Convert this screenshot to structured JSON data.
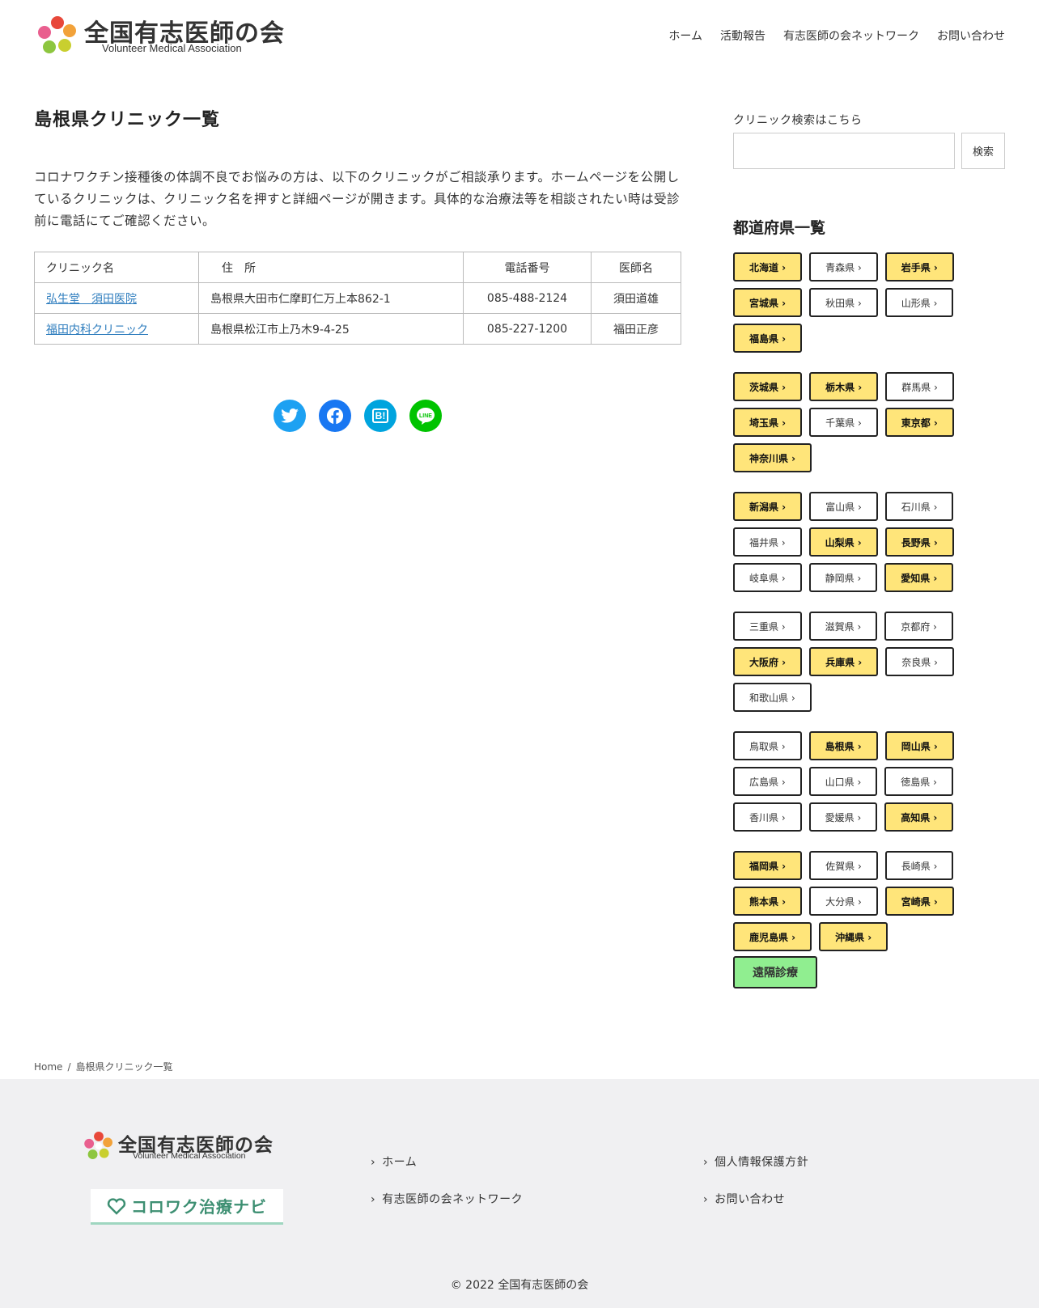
{
  "header": {
    "logo_title": "全国有志医師の会",
    "logo_subtitle": "Volunteer Medical Association",
    "nav": [
      "ホーム",
      "活動報告",
      "有志医師の会ネットワーク",
      "お問い合わせ"
    ]
  },
  "main": {
    "title": "島根県クリニック一覧",
    "intro": "コロナワクチン接種後の体調不良でお悩みの方は、以下のクリニックがご相談承ります。ホームページを公開しているクリニックは、クリニック名を押すと詳細ページが開きます。具体的な治療法等を相談されたい時は受診前に電話にてご確認ください。",
    "table": {
      "headers": [
        "クリニック名",
        "住　所",
        "電話番号",
        "医師名"
      ],
      "rows": [
        [
          "弘生堂　須田医院",
          "島根県大田市仁摩町仁万上本862-1",
          "085-488-2124",
          "須田道雄"
        ],
        [
          "福田内科クリニック",
          "島根県松江市上乃木9-4-25",
          "085-227-1200",
          "福田正彦"
        ]
      ]
    },
    "share": {
      "twitter_color": "#1da1f2",
      "facebook_color": "#1877f2",
      "hatena_color": "#00a4de",
      "line_color": "#00c300",
      "hatena_label": "B!"
    }
  },
  "sidebar": {
    "search_label": "クリニック検索はこちら",
    "search_button": "検索",
    "pref_title": "都道府県一覧",
    "groups": [
      [
        [
          "北海道 ›",
          true
        ],
        [
          "青森県 ›",
          false
        ],
        [
          "岩手県 ›",
          true
        ],
        [
          "宮城県 ›",
          true
        ],
        [
          "秋田県 ›",
          false
        ],
        [
          "山形県 ›",
          false
        ],
        [
          "福島県 ›",
          true
        ]
      ],
      [
        [
          "茨城県 ›",
          true
        ],
        [
          "栃木県 ›",
          true
        ],
        [
          "群馬県 ›",
          false
        ],
        [
          "埼玉県 ›",
          true
        ],
        [
          "千葉県 ›",
          false
        ],
        [
          "東京都 ›",
          true
        ],
        [
          "神奈川県 ›",
          true
        ]
      ],
      [
        [
          "新潟県 ›",
          true
        ],
        [
          "富山県 ›",
          false
        ],
        [
          "石川県 ›",
          false
        ],
        [
          "福井県 ›",
          false
        ],
        [
          "山梨県 ›",
          true
        ],
        [
          "長野県 ›",
          true
        ],
        [
          "岐阜県 ›",
          false
        ],
        [
          "静岡県 ›",
          false
        ],
        [
          "愛知県 ›",
          true
        ]
      ],
      [
        [
          "三重県 ›",
          false
        ],
        [
          "滋賀県 ›",
          false
        ],
        [
          "京都府 ›",
          false
        ],
        [
          "大阪府 ›",
          true
        ],
        [
          "兵庫県 ›",
          true
        ],
        [
          "奈良県 ›",
          false
        ],
        [
          "和歌山県 ›",
          false
        ]
      ],
      [
        [
          "鳥取県 ›",
          false
        ],
        [
          "島根県 ›",
          true
        ],
        [
          "岡山県 ›",
          true
        ],
        [
          "広島県 ›",
          false
        ],
        [
          "山口県 ›",
          false
        ],
        [
          "徳島県 ›",
          false
        ],
        [
          "香川県 ›",
          false
        ],
        [
          "愛媛県 ›",
          false
        ],
        [
          "高知県 ›",
          true
        ]
      ],
      [
        [
          "福岡県 ›",
          true
        ],
        [
          "佐賀県 ›",
          false
        ],
        [
          "長崎県 ›",
          false
        ],
        [
          "熊本県 ›",
          true
        ],
        [
          "大分県 ›",
          false
        ],
        [
          "宮崎県 ›",
          true
        ],
        [
          "鹿児島県 ›",
          true
        ],
        [
          "沖縄県 ›",
          true
        ]
      ]
    ],
    "remote_label": "遠隔診療",
    "highlight_color": "#ffe57a",
    "remote_color": "#90ee90"
  },
  "breadcrumb": {
    "home": "Home",
    "current": "島根県クリニック一覧"
  },
  "footer": {
    "logo_title": "全国有志医師の会",
    "logo_subtitle": "Volunteer Medical Association",
    "banner_text": "コロワク治療ナビ",
    "links_col1": [
      "ホーム",
      "有志医師の会ネットワーク"
    ],
    "links_col2": [
      "個人情報保護方針",
      "お問い合わせ"
    ],
    "copyright": "© 2022 全国有志医師の会"
  }
}
